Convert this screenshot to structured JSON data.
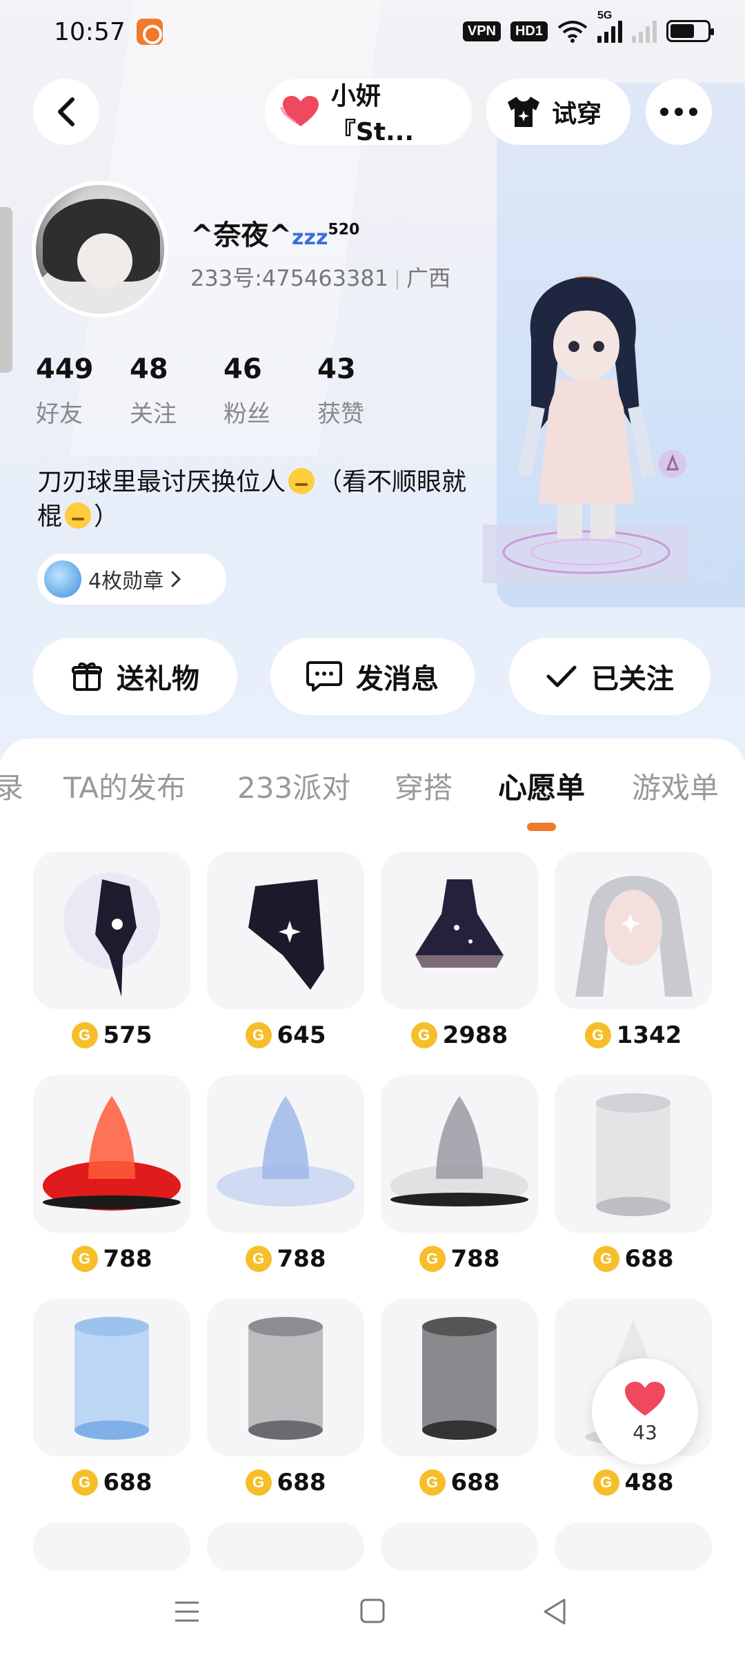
{
  "status_bar": {
    "time": "10:57",
    "vpn": "VPN",
    "hd": "HD1",
    "net": "5G"
  },
  "top_nav": {
    "music_chip_label": "小妍 『St...",
    "tryon_label": "试穿"
  },
  "profile": {
    "nickname": "^奈夜^",
    "nickname_zz": "zzz",
    "nickname_suffix": "520",
    "id_text": "233号:475463381",
    "region": "广西",
    "stats": [
      {
        "value": "449",
        "label": "好友"
      },
      {
        "value": "48",
        "label": "关注"
      },
      {
        "value": "46",
        "label": "粉丝"
      },
      {
        "value": "43",
        "label": "获赞"
      }
    ],
    "bio_part1": "刀刃球里最讨厌换位人",
    "bio_part2": "（看不顺眼就棍",
    "bio_part3": "）",
    "medal_label": "4枚勋章"
  },
  "actions": {
    "gift": "送礼物",
    "message": "发消息",
    "followed": "已关注"
  },
  "tabs": [
    {
      "label": "录"
    },
    {
      "label": "TA的发布"
    },
    {
      "label": "233派对"
    },
    {
      "label": "穿搭"
    },
    {
      "label": "心愿单",
      "active": true
    },
    {
      "label": "游戏单"
    }
  ],
  "wishlist": {
    "items": [
      {
        "price": "575",
        "icon": "dark-glove-icon"
      },
      {
        "price": "645",
        "icon": "dark-cape-icon"
      },
      {
        "price": "2988",
        "icon": "starry-dress-icon"
      },
      {
        "price": "1342",
        "icon": "silver-twintail-hair-icon"
      },
      {
        "price": "788",
        "icon": "red-flame-effect-icon"
      },
      {
        "price": "788",
        "icon": "blue-ice-effect-icon"
      },
      {
        "price": "788",
        "icon": "grey-swirl-effect-icon"
      },
      {
        "price": "688",
        "icon": "white-pillar-effect-icon"
      },
      {
        "price": "688",
        "icon": "blue-pillar-effect-icon"
      },
      {
        "price": "688",
        "icon": "silver-pillar-effect-icon"
      },
      {
        "price": "688",
        "icon": "dark-pillar-effect-icon"
      },
      {
        "price": "488",
        "icon": "white-crystal-effect-icon"
      }
    ]
  },
  "like_fab": {
    "count": "43"
  },
  "colors": {
    "accent": "#f07a2a",
    "coin": "#f6be2a",
    "heart": "#f0485e"
  }
}
